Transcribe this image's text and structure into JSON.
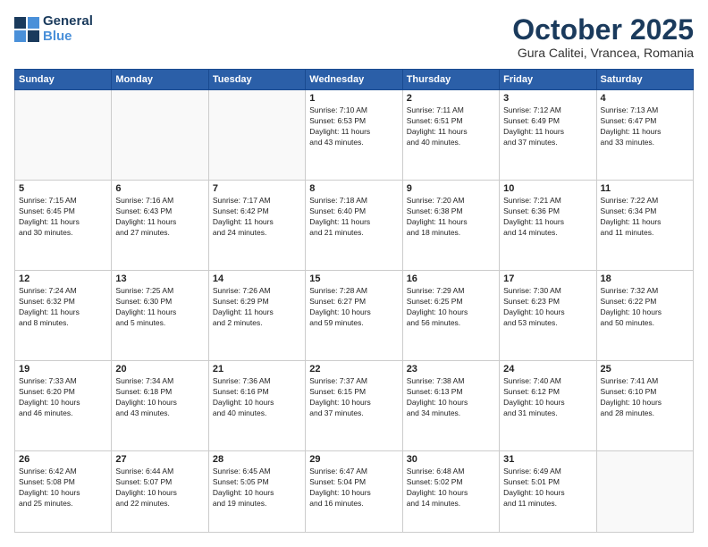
{
  "logo": {
    "line1": "General",
    "line2": "Blue"
  },
  "header": {
    "month": "October 2025",
    "location": "Gura Calitei, Vrancea, Romania"
  },
  "weekdays": [
    "Sunday",
    "Monday",
    "Tuesday",
    "Wednesday",
    "Thursday",
    "Friday",
    "Saturday"
  ],
  "weeks": [
    [
      {
        "day": "",
        "info": ""
      },
      {
        "day": "",
        "info": ""
      },
      {
        "day": "",
        "info": ""
      },
      {
        "day": "1",
        "info": "Sunrise: 7:10 AM\nSunset: 6:53 PM\nDaylight: 11 hours\nand 43 minutes."
      },
      {
        "day": "2",
        "info": "Sunrise: 7:11 AM\nSunset: 6:51 PM\nDaylight: 11 hours\nand 40 minutes."
      },
      {
        "day": "3",
        "info": "Sunrise: 7:12 AM\nSunset: 6:49 PM\nDaylight: 11 hours\nand 37 minutes."
      },
      {
        "day": "4",
        "info": "Sunrise: 7:13 AM\nSunset: 6:47 PM\nDaylight: 11 hours\nand 33 minutes."
      }
    ],
    [
      {
        "day": "5",
        "info": "Sunrise: 7:15 AM\nSunset: 6:45 PM\nDaylight: 11 hours\nand 30 minutes."
      },
      {
        "day": "6",
        "info": "Sunrise: 7:16 AM\nSunset: 6:43 PM\nDaylight: 11 hours\nand 27 minutes."
      },
      {
        "day": "7",
        "info": "Sunrise: 7:17 AM\nSunset: 6:42 PM\nDaylight: 11 hours\nand 24 minutes."
      },
      {
        "day": "8",
        "info": "Sunrise: 7:18 AM\nSunset: 6:40 PM\nDaylight: 11 hours\nand 21 minutes."
      },
      {
        "day": "9",
        "info": "Sunrise: 7:20 AM\nSunset: 6:38 PM\nDaylight: 11 hours\nand 18 minutes."
      },
      {
        "day": "10",
        "info": "Sunrise: 7:21 AM\nSunset: 6:36 PM\nDaylight: 11 hours\nand 14 minutes."
      },
      {
        "day": "11",
        "info": "Sunrise: 7:22 AM\nSunset: 6:34 PM\nDaylight: 11 hours\nand 11 minutes."
      }
    ],
    [
      {
        "day": "12",
        "info": "Sunrise: 7:24 AM\nSunset: 6:32 PM\nDaylight: 11 hours\nand 8 minutes."
      },
      {
        "day": "13",
        "info": "Sunrise: 7:25 AM\nSunset: 6:30 PM\nDaylight: 11 hours\nand 5 minutes."
      },
      {
        "day": "14",
        "info": "Sunrise: 7:26 AM\nSunset: 6:29 PM\nDaylight: 11 hours\nand 2 minutes."
      },
      {
        "day": "15",
        "info": "Sunrise: 7:28 AM\nSunset: 6:27 PM\nDaylight: 10 hours\nand 59 minutes."
      },
      {
        "day": "16",
        "info": "Sunrise: 7:29 AM\nSunset: 6:25 PM\nDaylight: 10 hours\nand 56 minutes."
      },
      {
        "day": "17",
        "info": "Sunrise: 7:30 AM\nSunset: 6:23 PM\nDaylight: 10 hours\nand 53 minutes."
      },
      {
        "day": "18",
        "info": "Sunrise: 7:32 AM\nSunset: 6:22 PM\nDaylight: 10 hours\nand 50 minutes."
      }
    ],
    [
      {
        "day": "19",
        "info": "Sunrise: 7:33 AM\nSunset: 6:20 PM\nDaylight: 10 hours\nand 46 minutes."
      },
      {
        "day": "20",
        "info": "Sunrise: 7:34 AM\nSunset: 6:18 PM\nDaylight: 10 hours\nand 43 minutes."
      },
      {
        "day": "21",
        "info": "Sunrise: 7:36 AM\nSunset: 6:16 PM\nDaylight: 10 hours\nand 40 minutes."
      },
      {
        "day": "22",
        "info": "Sunrise: 7:37 AM\nSunset: 6:15 PM\nDaylight: 10 hours\nand 37 minutes."
      },
      {
        "day": "23",
        "info": "Sunrise: 7:38 AM\nSunset: 6:13 PM\nDaylight: 10 hours\nand 34 minutes."
      },
      {
        "day": "24",
        "info": "Sunrise: 7:40 AM\nSunset: 6:12 PM\nDaylight: 10 hours\nand 31 minutes."
      },
      {
        "day": "25",
        "info": "Sunrise: 7:41 AM\nSunset: 6:10 PM\nDaylight: 10 hours\nand 28 minutes."
      }
    ],
    [
      {
        "day": "26",
        "info": "Sunrise: 6:42 AM\nSunset: 5:08 PM\nDaylight: 10 hours\nand 25 minutes."
      },
      {
        "day": "27",
        "info": "Sunrise: 6:44 AM\nSunset: 5:07 PM\nDaylight: 10 hours\nand 22 minutes."
      },
      {
        "day": "28",
        "info": "Sunrise: 6:45 AM\nSunset: 5:05 PM\nDaylight: 10 hours\nand 19 minutes."
      },
      {
        "day": "29",
        "info": "Sunrise: 6:47 AM\nSunset: 5:04 PM\nDaylight: 10 hours\nand 16 minutes."
      },
      {
        "day": "30",
        "info": "Sunrise: 6:48 AM\nSunset: 5:02 PM\nDaylight: 10 hours\nand 14 minutes."
      },
      {
        "day": "31",
        "info": "Sunrise: 6:49 AM\nSunset: 5:01 PM\nDaylight: 10 hours\nand 11 minutes."
      },
      {
        "day": "",
        "info": ""
      }
    ]
  ]
}
